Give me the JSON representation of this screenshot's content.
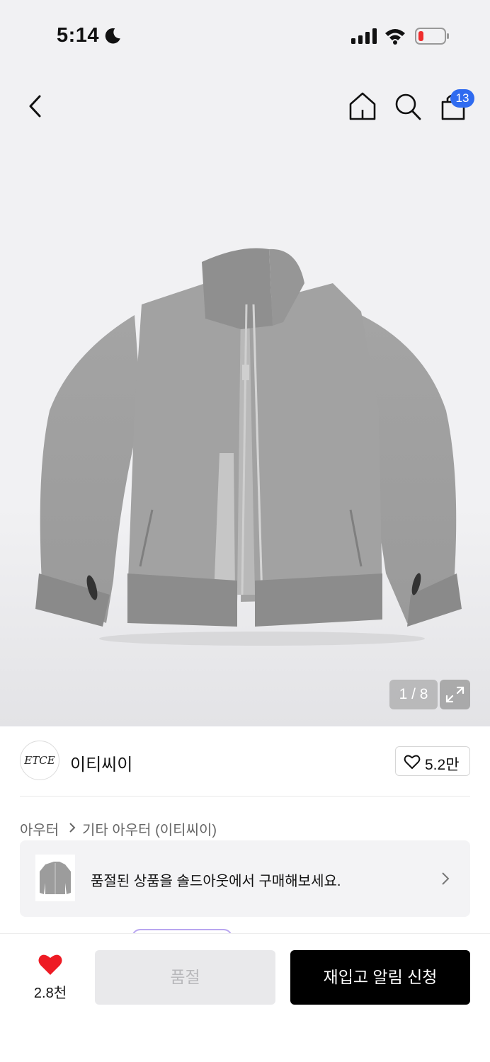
{
  "status_bar": {
    "time": "5:14"
  },
  "header": {
    "cart_count": "13"
  },
  "gallery": {
    "pager": "1 / 8"
  },
  "brand": {
    "logo_text": "ETCE",
    "name": "이티씨이",
    "likes": "5.2만"
  },
  "breadcrumb": {
    "level1": "아우터",
    "level2": "기타 아우터 (이티씨이)"
  },
  "soldout_banner": {
    "text": "품절된 상품을 솔드아웃에서 구매해보세요."
  },
  "bottom_bar": {
    "wish_count": "2.8천",
    "soldout_label": "품절",
    "restock_label": "재입고 알림 신청"
  },
  "colors": {
    "accent_blue": "#2f6bf0",
    "heart_red": "#ee1b24",
    "primary_button": "#000000"
  }
}
